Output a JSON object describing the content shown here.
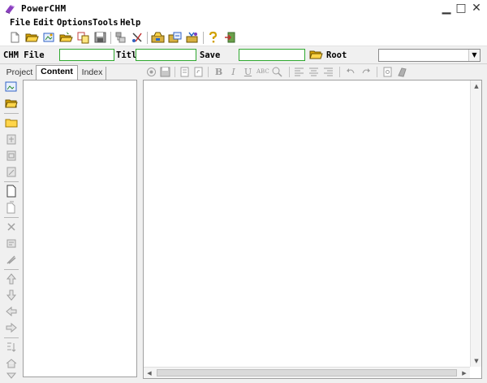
{
  "window": {
    "title": "PowerCHM",
    "minimize_label": "▁",
    "maximize_label": "□",
    "close_label": "✕"
  },
  "menu": [
    {
      "label": "File"
    },
    {
      "label": "Edit"
    },
    {
      "label": "Options"
    },
    {
      "label": "Tools"
    },
    {
      "label": "Help"
    }
  ],
  "toolbar": {
    "icons": [
      "new-file-icon",
      "open-folder-icon",
      "open-project-icon",
      "open-file-icon",
      "copy-icon",
      "save-icon",
      "wizard-icon",
      "tool-icon",
      "compile-icon",
      "compile-view-icon",
      "decompile-icon",
      "help-icon",
      "exit-icon"
    ]
  },
  "fields": {
    "chm_file_label": "CHM File",
    "title_label": "Titl",
    "save_label": "Save",
    "root_label": "Root",
    "chm_file_value": "",
    "title_value": "",
    "save_value": "",
    "root_value": ""
  },
  "tabs": [
    {
      "label": "Project"
    },
    {
      "label": "Content",
      "active": true
    },
    {
      "label": "Index"
    }
  ],
  "left_tools": [
    "open-image-icon",
    "open-folder-icon",
    "folder-icon",
    "add-item-icon",
    "image-item-icon",
    "edit-item-icon",
    "new-page-icon",
    "copy-page-icon",
    "delete-icon",
    "properties-icon",
    "clean-icon",
    "move-up-icon",
    "move-down-icon",
    "move-left-icon",
    "move-right-icon",
    "sort-icon",
    "home-icon",
    "bottom-icon"
  ],
  "editor_toolbar": {
    "bold_label": "B",
    "italic_label": "I",
    "underline_label": "U",
    "spell_label": "ABC"
  },
  "colors": {
    "field_border": "#2ea82e",
    "panel_bg": "#f0f0f0"
  }
}
